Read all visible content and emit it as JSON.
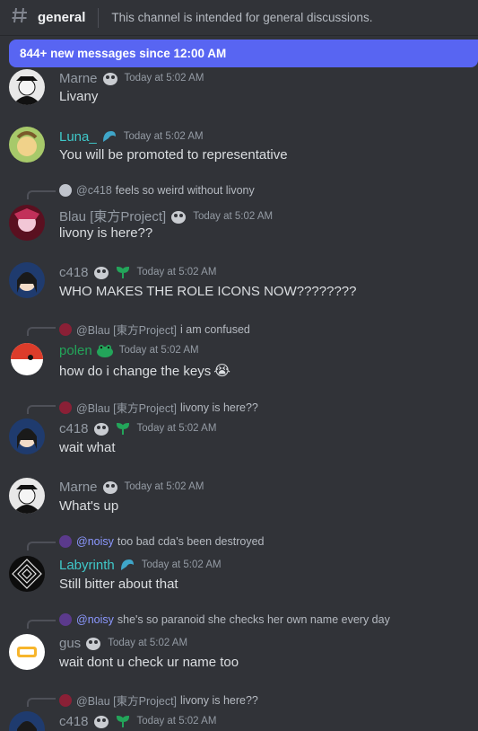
{
  "header": {
    "channel": "general",
    "topic": "This channel is intended for general discussions."
  },
  "banner": {
    "text": "844+ new messages since 12:00 AM"
  },
  "colors": {
    "background": "#313338",
    "banner": "#5865f2",
    "default_name": "#949ba4",
    "luna": "#3fc8c9",
    "polen": "#23a55a",
    "labyrinth": "#3fc8c9",
    "noisy_reply": "#8c98ff"
  },
  "messages": [
    {
      "author": "Marne",
      "timestamp": "Today at 5:02 AM",
      "text": "Livany",
      "name_color": "#949ba4",
      "avatar_icon": "marne-avatar-icon"
    },
    {
      "author": "Luna_",
      "timestamp": "Today at 5:02 AM",
      "text": "You will be promoted to representative",
      "name_color": "#3fc8c9",
      "avatar_icon": "luna-avatar-icon"
    },
    {
      "reply_to": "@c418",
      "reply_text": "feels so weird without livony",
      "author": "Blau [東方Project]",
      "timestamp": "Today at 5:02 AM",
      "text": "livony is here??",
      "name_color": "#949ba4",
      "avatar_icon": "blau-avatar-icon"
    },
    {
      "author": "c418",
      "timestamp": "Today at 5:02 AM",
      "text": "WHO MAKES THE ROLE ICONS NOW????????",
      "name_color": "#949ba4",
      "avatar_icon": "c418-avatar-icon"
    },
    {
      "reply_to": "@Blau [東方Project]",
      "reply_text": "i am confused",
      "author": "polen",
      "timestamp": "Today at 5:02 AM",
      "text": "how do i change the keys",
      "emoji": "😭",
      "name_color": "#23a55a",
      "avatar_icon": "polen-avatar-icon"
    },
    {
      "reply_to": "@Blau [東方Project]",
      "reply_text": "livony is here??",
      "author": "c418",
      "timestamp": "Today at 5:02 AM",
      "text": "wait what",
      "name_color": "#949ba4",
      "avatar_icon": "c418-avatar-icon"
    },
    {
      "author": "Marne",
      "timestamp": "Today at 5:02 AM",
      "text": "What's up",
      "name_color": "#949ba4",
      "avatar_icon": "marne-avatar-icon"
    },
    {
      "reply_to": "@noisy",
      "reply_text": "too bad cda's been destroyed",
      "author": "Labyrinth",
      "timestamp": "Today at 5:02 AM",
      "text": "Still bitter about that",
      "name_color": "#3fc8c9",
      "avatar_icon": "labyrinth-avatar-icon"
    },
    {
      "reply_to": "@noisy",
      "reply_text": "she's so paranoid she checks her own name every day",
      "author": "gus",
      "timestamp": "Today at 5:02 AM",
      "text": "wait dont u check ur name too",
      "name_color": "#949ba4",
      "avatar_icon": "gus-avatar-icon"
    },
    {
      "reply_to": "@Blau [東方Project]",
      "reply_text": "livony is here??",
      "author": "c418",
      "timestamp": "Today at 5:02 AM",
      "text": "",
      "name_color": "#949ba4",
      "avatar_icon": "c418-avatar-icon"
    }
  ]
}
